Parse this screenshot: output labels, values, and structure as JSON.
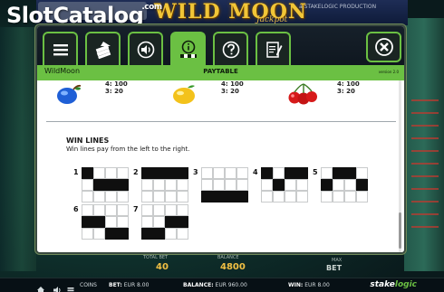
{
  "watermark": {
    "name": "SlotCatalog",
    "suffix": ".com"
  },
  "background": {
    "game_logo": "WILD MOON",
    "game_logo_sub": "Jackpot",
    "studio_small": "a STAKELOGIC PRODUCTION",
    "total_bet_label": "TOTAL BET",
    "total_bet_value": "40",
    "balance_label": "BALANCE",
    "balance_value": "4800",
    "max_bet_label": "MAX",
    "max_bet_label2": "BET"
  },
  "navbar": {
    "buttons": [
      {
        "name": "menu",
        "icon": "hamburger-icon"
      },
      {
        "name": "bet-settings",
        "icon": "coins-arrow-icon"
      },
      {
        "name": "sound",
        "icon": "speaker-icon"
      },
      {
        "name": "paytable",
        "icon": "paytable-icon",
        "active": true
      },
      {
        "name": "help",
        "icon": "question-icon"
      },
      {
        "name": "history",
        "icon": "document-pencil-icon"
      }
    ],
    "close_icon": "close-x-icon"
  },
  "titlebar": {
    "game_name": "WildMoon",
    "title": "PAYTABLE",
    "version": "version 2.0"
  },
  "symbols": [
    {
      "icon": "plum-icon",
      "line1": "4: 100",
      "line2": "3: 20"
    },
    {
      "icon": "lemon-icon",
      "line1": "4: 100",
      "line2": "3: 20"
    },
    {
      "icon": "cherry-icon",
      "line1": "4: 100",
      "line2": "3: 20"
    }
  ],
  "win_lines": {
    "title": "WIN LINES",
    "description": "Win lines pay from the left to the right.",
    "lines": [
      {
        "number": "1",
        "rows": [
          0,
          1,
          1,
          1
        ]
      },
      {
        "number": "2",
        "rows": [
          0,
          0,
          0,
          0
        ]
      },
      {
        "number": "3",
        "rows": [
          2,
          2,
          2,
          2
        ]
      },
      {
        "number": "4",
        "rows": [
          0,
          1,
          0,
          0
        ]
      },
      {
        "number": "5",
        "rows": [
          1,
          0,
          0,
          1
        ]
      },
      {
        "number": "6",
        "rows": [
          1,
          1,
          2,
          2
        ]
      },
      {
        "number": "7",
        "rows": [
          2,
          2,
          1,
          1
        ]
      }
    ]
  },
  "statusbar": {
    "coins_label": "COINS",
    "bet_label": "BET:",
    "bet_value": "EUR 8.00",
    "balance_label": "BALANCE:",
    "balance_value": "EUR 960.00",
    "win_label": "WIN:",
    "win_value": "EUR 8.00",
    "brand_a": "stake",
    "brand_b": "logic"
  },
  "colors": {
    "accent": "#6bc043",
    "dark": "#16202a"
  }
}
